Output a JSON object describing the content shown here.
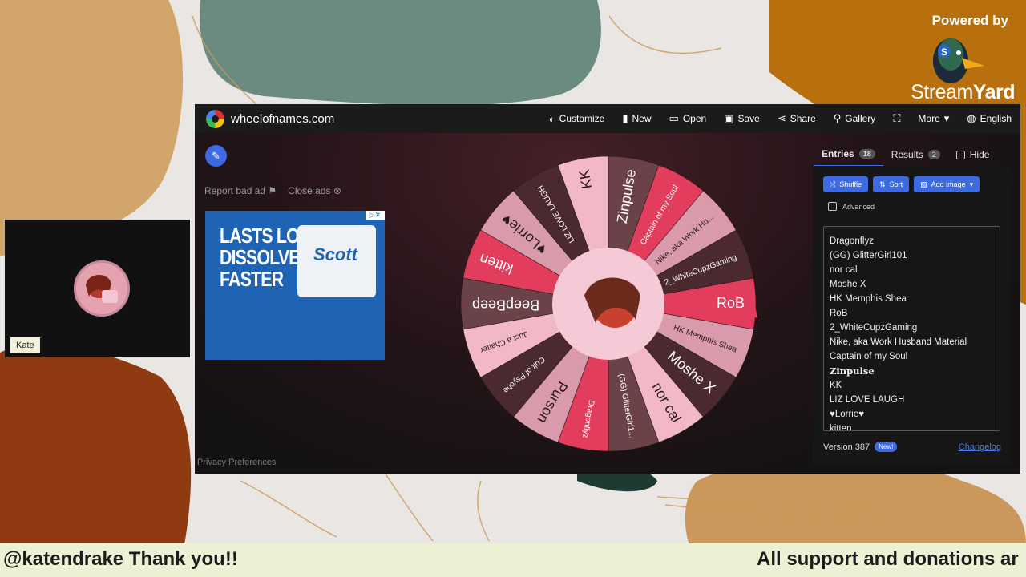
{
  "overlay": {
    "powered_by": "Powered by",
    "brand_part1": "Stream",
    "brand_part2": "Yard",
    "camera_name": "Kate",
    "ticker_left": "@katendrake Thank you!!",
    "ticker_right": "All support and donations ar"
  },
  "browser": {
    "site": "wheelofnames.com",
    "menu": [
      {
        "label": "Customize",
        "icon": "palette-icon"
      },
      {
        "label": "New",
        "icon": "file-icon"
      },
      {
        "label": "Open",
        "icon": "folder-icon"
      },
      {
        "label": "Save",
        "icon": "save-icon"
      },
      {
        "label": "Share",
        "icon": "share-icon"
      },
      {
        "label": "Gallery",
        "icon": "search-icon"
      },
      {
        "label": "",
        "icon": "fullscreen-icon"
      },
      {
        "label": "More",
        "icon": "chevron-down-icon"
      },
      {
        "label": "English",
        "icon": "globe-icon"
      }
    ]
  },
  "ads": {
    "report": "Report bad ad",
    "close": "Close ads",
    "headline": "LASTS LONGER. DISSOLVES FASTER",
    "product": "Scott",
    "privacy": "Privacy Preferences"
  },
  "wheel": {
    "segments": [
      "RoB",
      "HK Memphis Shea",
      "Moshe X",
      "nor cal",
      "(GG) GlitterGirl1...",
      "Dragonflyz",
      "Purson",
      "Cult of Psyche",
      "Just a Chatter",
      "BeepBeep",
      "kitten",
      "♥Lorrie♥",
      "LIZ LOVE LAUGH",
      "KK",
      "Zinpulse",
      "Captain of my Soul",
      "Nike, aka Work Hu...",
      "2_WhiteCupzGaming"
    ],
    "colors": [
      "#e23d5c",
      "#d99aab",
      "#4a2a2e",
      "#f3b8c8",
      "#6a4247"
    ]
  },
  "panel": {
    "tab_entries": "Entries",
    "entries_count": "18",
    "tab_results": "Results",
    "results_count": "2",
    "hide": "Hide",
    "shuffle": "Shuffle",
    "sort": "Sort",
    "add_image": "Add image",
    "advanced": "Advanced",
    "entries": [
      "Dragonflyz",
      "(GG) GlitterGirl101",
      "nor cal",
      "Moshe X",
      "HK Memphis Shea",
      "RoB",
      "2_WhiteCupzGaming",
      "Nike, aka Work Husband Material",
      "Captain of my Soul",
      "Zinpulse",
      "KK",
      "LIZ LOVE LAUGH",
      "♥Lorrie♥",
      "kitten"
    ],
    "version": "Version 387",
    "new_badge": "New!",
    "changelog": "Changelog"
  }
}
